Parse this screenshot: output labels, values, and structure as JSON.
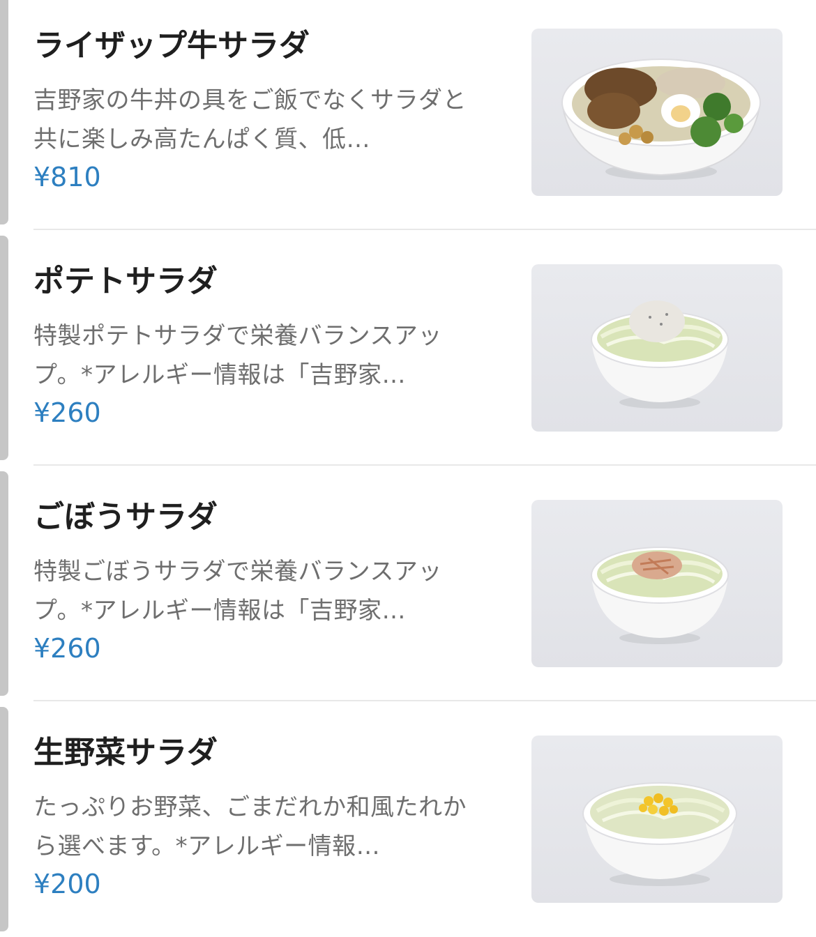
{
  "menu": {
    "items": [
      {
        "title": "ライザップ牛サラダ",
        "description": "吉野家の牛丼の具をご飯でなくサラダと共に楽しみ高たんぱく質、低…",
        "price": "¥810",
        "image_icon": "beef-salad-bowl-photo"
      },
      {
        "title": "ポテトサラダ",
        "description": "特製ポテトサラダで栄養バランスアップ。*アレルギー情報は「吉野家…",
        "price": "¥260",
        "image_icon": "potato-salad-bowl-photo"
      },
      {
        "title": "ごぼうサラダ",
        "description": "特製ごぼうサラダで栄養バランスアップ。*アレルギー情報は「吉野家…",
        "price": "¥260",
        "image_icon": "burdock-salad-bowl-photo"
      },
      {
        "title": "生野菜サラダ",
        "description": "たっぷりお野菜、ごまだれか和風たれから選べます。*アレルギー情報…",
        "price": "¥200",
        "image_icon": "fresh-vegetable-salad-bowl-photo"
      }
    ]
  },
  "colors": {
    "title": "#1f1f1f",
    "description": "#6e6e6e",
    "price": "#2d7fc0",
    "divider": "#e8e8e8",
    "edge": "#c6c6c6"
  }
}
